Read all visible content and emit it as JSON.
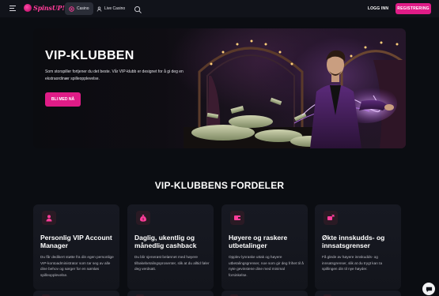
{
  "header": {
    "logo_text": "SpinsUP!",
    "tabs": [
      {
        "label": "Casino",
        "icon": "casino-chip-icon",
        "active": true
      },
      {
        "label": "Live Casino",
        "icon": "dealer-icon",
        "active": false
      }
    ],
    "login_label": "LOGG INN",
    "register_label": "REGISTRERING",
    "accent": "#e01c87"
  },
  "hero": {
    "title": "VIP-KLUBBEN",
    "description": "Som storspiller fortjener du det beste. Vår VIP-klubb er designet for å gi deg en ekstraordinær spilleopplevelse.",
    "cta_label": "BLI MED NÅ"
  },
  "section": {
    "title": "VIP-KLUBBENS FORDELER"
  },
  "cards": [
    {
      "icon": "vip-manager-icon",
      "title": "Personlig VIP Account Manager",
      "text": "Du får dedikert støtte fra din egen personlige VIP-kontoadministrator som tar seg av alle dine behov og sørger for en sømløs spilleopplevelse."
    },
    {
      "icon": "money-bag-icon",
      "title": "Daglig, ukentlig og månedlig cashback",
      "text": "Du blir sjenerøst belønnet med høyere tilbakebetalingsprosenter, slik at du alltid føler deg verdsatt."
    },
    {
      "icon": "withdraw-icon",
      "title": "Høyere og raskere utbetalinger",
      "text": "Opplev lynraske uttak og høyere utbetalingsgrenser, noe som gir deg frihet til å nyte gevinstene dine med minimal forsinkelse."
    },
    {
      "icon": "deposit-limit-icon",
      "title": "Økte innskudds- og innsatsgrenser",
      "text": "Få glede av høyere innskudds- og innsatsgrenser, slik at du trygt kan ta spillingen din til nye høyder."
    }
  ],
  "chat": {
    "icon": "chat-icon"
  }
}
